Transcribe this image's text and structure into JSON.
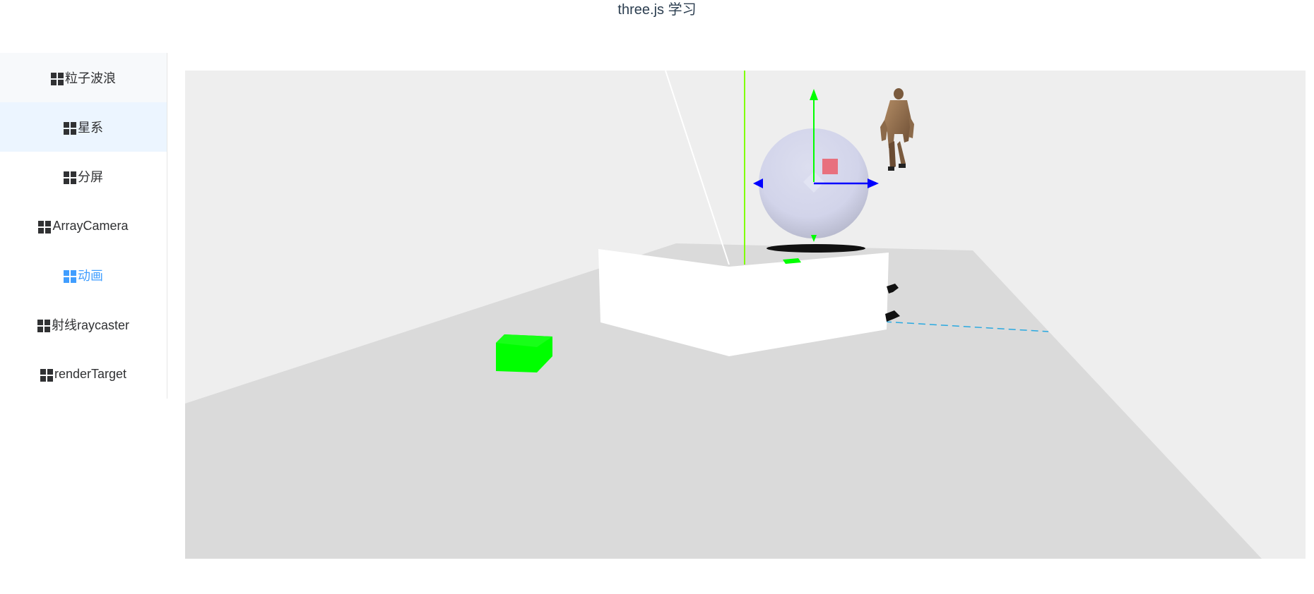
{
  "header": {
    "title": "three.js 学习"
  },
  "sidebar": {
    "items": [
      {
        "label": "粒子波浪",
        "icon": "grid-icon",
        "state": "hover"
      },
      {
        "label": "星系",
        "icon": "grid-icon",
        "state": "highlight"
      },
      {
        "label": "分屏",
        "icon": "grid-icon",
        "state": "normal"
      },
      {
        "label": "ArrayCamera",
        "icon": "grid-icon",
        "state": "normal"
      },
      {
        "label": "动画",
        "icon": "grid-icon",
        "state": "active"
      },
      {
        "label": "射线raycaster",
        "icon": "grid-icon",
        "state": "normal"
      },
      {
        "label": "renderTarget",
        "icon": "grid-icon",
        "state": "normal"
      }
    ]
  },
  "scene": {
    "background_color": "#eeeeee",
    "ground_color": "#dadada",
    "sphere_color": "#d4d6ec",
    "cube_color": "#00ff00",
    "arrow_x_color": "#0000ff",
    "arrow_y_color": "#00ff00",
    "marker_color": "#e8707e",
    "wall_color": "#ffffff",
    "dashed_line_color": "#2aa9e0"
  },
  "colors": {
    "active": "#409eff",
    "text": "#303133",
    "highlight_bg": "#ecf5ff"
  }
}
